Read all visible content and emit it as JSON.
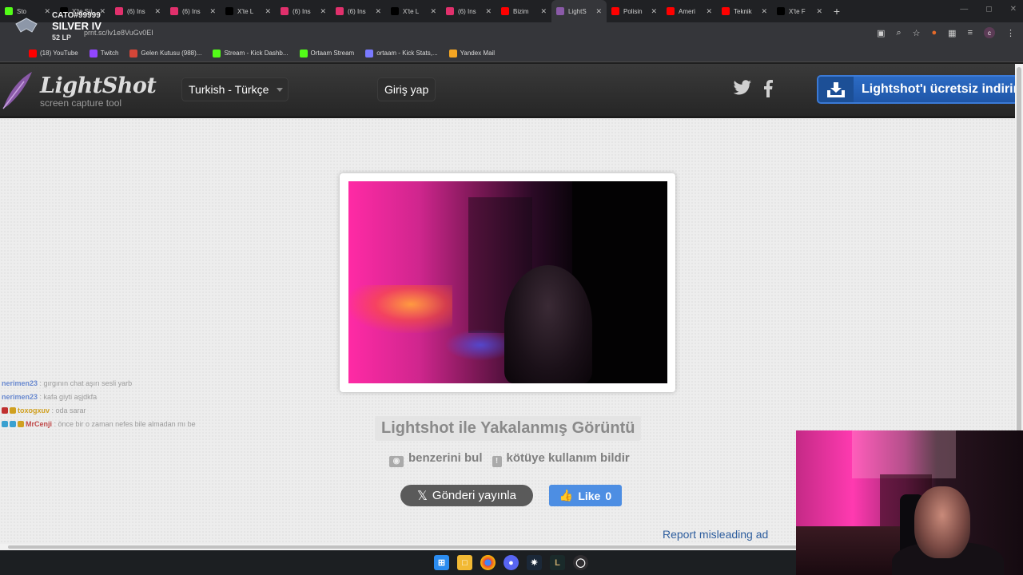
{
  "browser": {
    "tabs": [
      {
        "title": "Sto",
        "favicon": "kick-icon",
        "color": "#53fc18"
      },
      {
        "title": "X'te Sü",
        "favicon": "x-icon",
        "color": "#000000"
      },
      {
        "title": "(6) Ins",
        "favicon": "instagram-icon",
        "color": "#e1306c"
      },
      {
        "title": "(6) Ins",
        "favicon": "instagram-icon",
        "color": "#e1306c"
      },
      {
        "title": "X'te L",
        "favicon": "x-icon",
        "color": "#000000"
      },
      {
        "title": "(6) Ins",
        "favicon": "instagram-icon",
        "color": "#e1306c"
      },
      {
        "title": "(6) Ins",
        "favicon": "instagram-icon",
        "color": "#e1306c"
      },
      {
        "title": "X'te L",
        "favicon": "x-icon",
        "color": "#000000"
      },
      {
        "title": "(6) Ins",
        "favicon": "instagram-icon",
        "color": "#e1306c"
      },
      {
        "title": "Bizim",
        "favicon": "youtube-icon",
        "color": "#ff0000"
      },
      {
        "title": "LightS",
        "favicon": "lightshot-icon",
        "color": "#8a5aa8",
        "active": true
      },
      {
        "title": "Polisin",
        "favicon": "youtube-icon",
        "color": "#ff0000"
      },
      {
        "title": "Ameri",
        "favicon": "youtube-icon",
        "color": "#ff0000"
      },
      {
        "title": "Teknik",
        "favicon": "youtube-icon",
        "color": "#ff0000"
      },
      {
        "title": "X'te F",
        "favicon": "x-icon",
        "color": "#000000"
      }
    ],
    "new_tab": "+",
    "url": "prnt.sc/lv1e8VuGv0EI",
    "profile_letter": "c",
    "bookmarks": [
      {
        "label": "(18) YouTube",
        "icon": "youtube-icon",
        "color": "#ff0000"
      },
      {
        "label": "Twitch",
        "icon": "twitch-icon",
        "color": "#9146ff"
      },
      {
        "label": "Gelen Kutusu (988)...",
        "icon": "gmail-icon",
        "color": "#d44638"
      },
      {
        "label": "Stream - Kick Dashb...",
        "icon": "kick-icon",
        "color": "#53fc18"
      },
      {
        "label": "Ortaam Stream",
        "icon": "kick-icon",
        "color": "#53fc18"
      },
      {
        "label": "ortaam - Kick Stats,...",
        "icon": "stats-icon",
        "color": "#7a7aff"
      },
      {
        "label": "Yandex Mail",
        "icon": "mail-icon",
        "color": "#f5a623"
      }
    ]
  },
  "rank_overlay": {
    "name": "CATO#99999",
    "tier": "SILVER IV",
    "lp": "52 LP"
  },
  "lightshot": {
    "logo_title": "LightShot",
    "logo_subtitle": "screen capture tool",
    "language": "Turkish - Türkçe",
    "login": "Giriş yap",
    "download": "Lightshot'ı ücretsiz indirin",
    "caption_title": "Lightshot ile Yakalanmış Görüntü",
    "find_similar": "benzerini bul",
    "report_abuse": "kötüye kullanım bildir",
    "post_button": "Gönderi yayınla",
    "like_label": "Like",
    "like_count": "0",
    "report_ad": "Report misleading ad"
  },
  "chat": [
    {
      "user": "nerimen23",
      "text": ": gırgının chat aşırı sesli yarb",
      "user_color": "#6a8ad0"
    },
    {
      "user": "nerimen23",
      "text": ": kafa giyti aşjdkfa",
      "user_color": "#6a8ad0"
    },
    {
      "user": "toxogxuv",
      "text": ": oda sarar",
      "user_color": "#d0a020"
    },
    {
      "user": "MrCenji",
      "text": ": önce bir o zaman nefes bile almadan mı be",
      "user_color": "#c04848"
    }
  ],
  "colors": {
    "accent_blue": "#2c6bc4",
    "like_blue": "#4d8ee3",
    "report_link": "#2e5e9e"
  }
}
